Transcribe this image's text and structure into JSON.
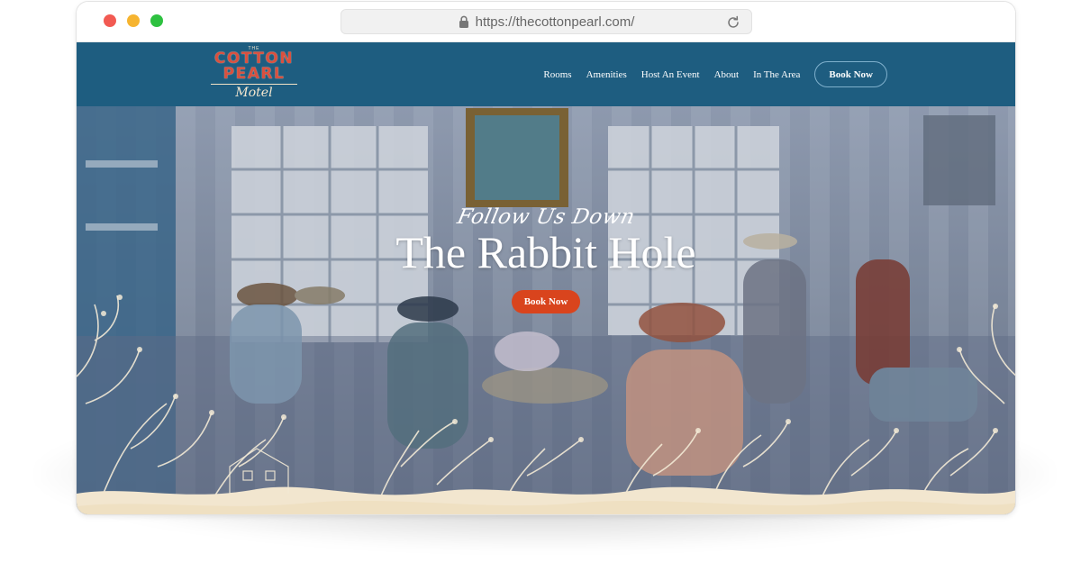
{
  "browser": {
    "url": "https://thecottonpearl.com/"
  },
  "logo": {
    "the": "THE",
    "line1": "COTTON",
    "line2": "PEARL",
    "line3": "Motel"
  },
  "nav": {
    "items": [
      {
        "label": "Rooms"
      },
      {
        "label": "Amenities"
      },
      {
        "label": "Host An Event"
      },
      {
        "label": "About"
      },
      {
        "label": "In The Area"
      }
    ],
    "book_label": "Book Now"
  },
  "hero": {
    "tagline": "Follow Us Down",
    "headline": "The Rabbit Hole",
    "book_label": "Book Now"
  },
  "colors": {
    "nav_bg": "#1e5d80",
    "accent": "#d9441d",
    "logo_red": "#d9503f",
    "cream": "#f4e7cf"
  },
  "icons": [
    "lock-icon",
    "reload-icon"
  ]
}
